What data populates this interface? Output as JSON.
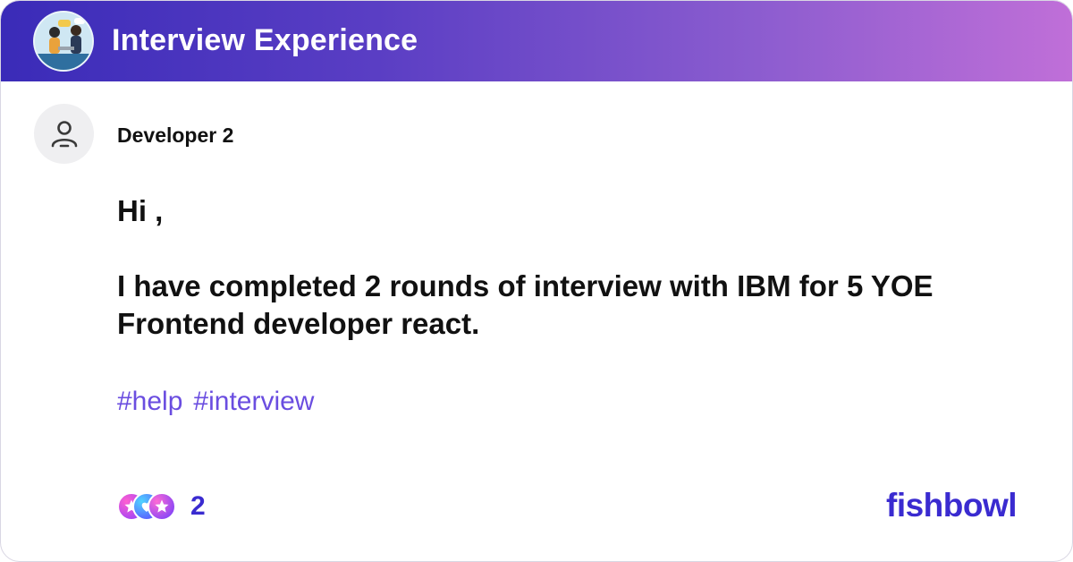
{
  "header": {
    "group_avatar_icon": "people-meeting-illustration",
    "title": "Interview Experience",
    "gradient_start": "#3a2bb8",
    "gradient_end": "#c06fd8"
  },
  "post": {
    "author": {
      "avatar_icon": "person-icon",
      "name": "Developer 2"
    },
    "greeting": "Hi ,",
    "body": "I have completed 2 rounds of interview with IBM for 5 YOE Frontend developer react.",
    "tags": [
      "#help",
      "#interview"
    ],
    "reactions": {
      "icons": [
        "star-reaction-icon",
        "heart-reaction-icon",
        "star-reaction-icon"
      ],
      "count": "2"
    }
  },
  "brand": {
    "logo_text": "fishbowl",
    "color": "#3a2bd0"
  },
  "colors": {
    "tag": "#6a4de0",
    "text": "#111111"
  }
}
